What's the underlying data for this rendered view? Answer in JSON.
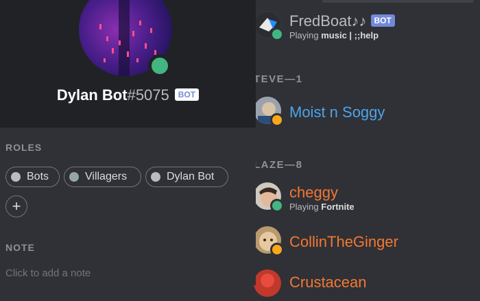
{
  "members": {
    "fredboat": {
      "name": "FredBoat♪♪",
      "badge": "BOT",
      "activity_prefix": "Playing ",
      "activity": "music | ;;help",
      "status_color": "#43b581",
      "name_color": "#b9bbbe"
    },
    "group1_header": "TEVE—1",
    "moist": {
      "name": "Moist n Soggy",
      "status_color": "#faa61a",
      "name_color": "#4ea3ea"
    },
    "group2_header": "LAZE—8",
    "cheggy": {
      "name": "cheggy",
      "activity_prefix": "Playing ",
      "activity": "Fortnite",
      "status_color": "#43b581",
      "name_color": "#f57731"
    },
    "collin": {
      "name": "CollinTheGinger",
      "status_color": "#faa61a",
      "name_color": "#f57731"
    },
    "crustacean": {
      "name": "Crustacean",
      "name_color": "#f57731"
    }
  },
  "profile": {
    "username": "Dylan Bot",
    "discriminator": "#5075",
    "badge": "BOT",
    "status_color": "#43b581",
    "roles_title": "ROLES",
    "roles": [
      {
        "label": "Bots",
        "color": "#b9bbbe"
      },
      {
        "label": "Villagers",
        "color": "#95a5a6"
      },
      {
        "label": "Dylan Bot",
        "color": "#b9bbbe"
      }
    ],
    "add_role_symbol": "+",
    "note_title": "NOTE",
    "note_placeholder": "Click to add a note"
  }
}
